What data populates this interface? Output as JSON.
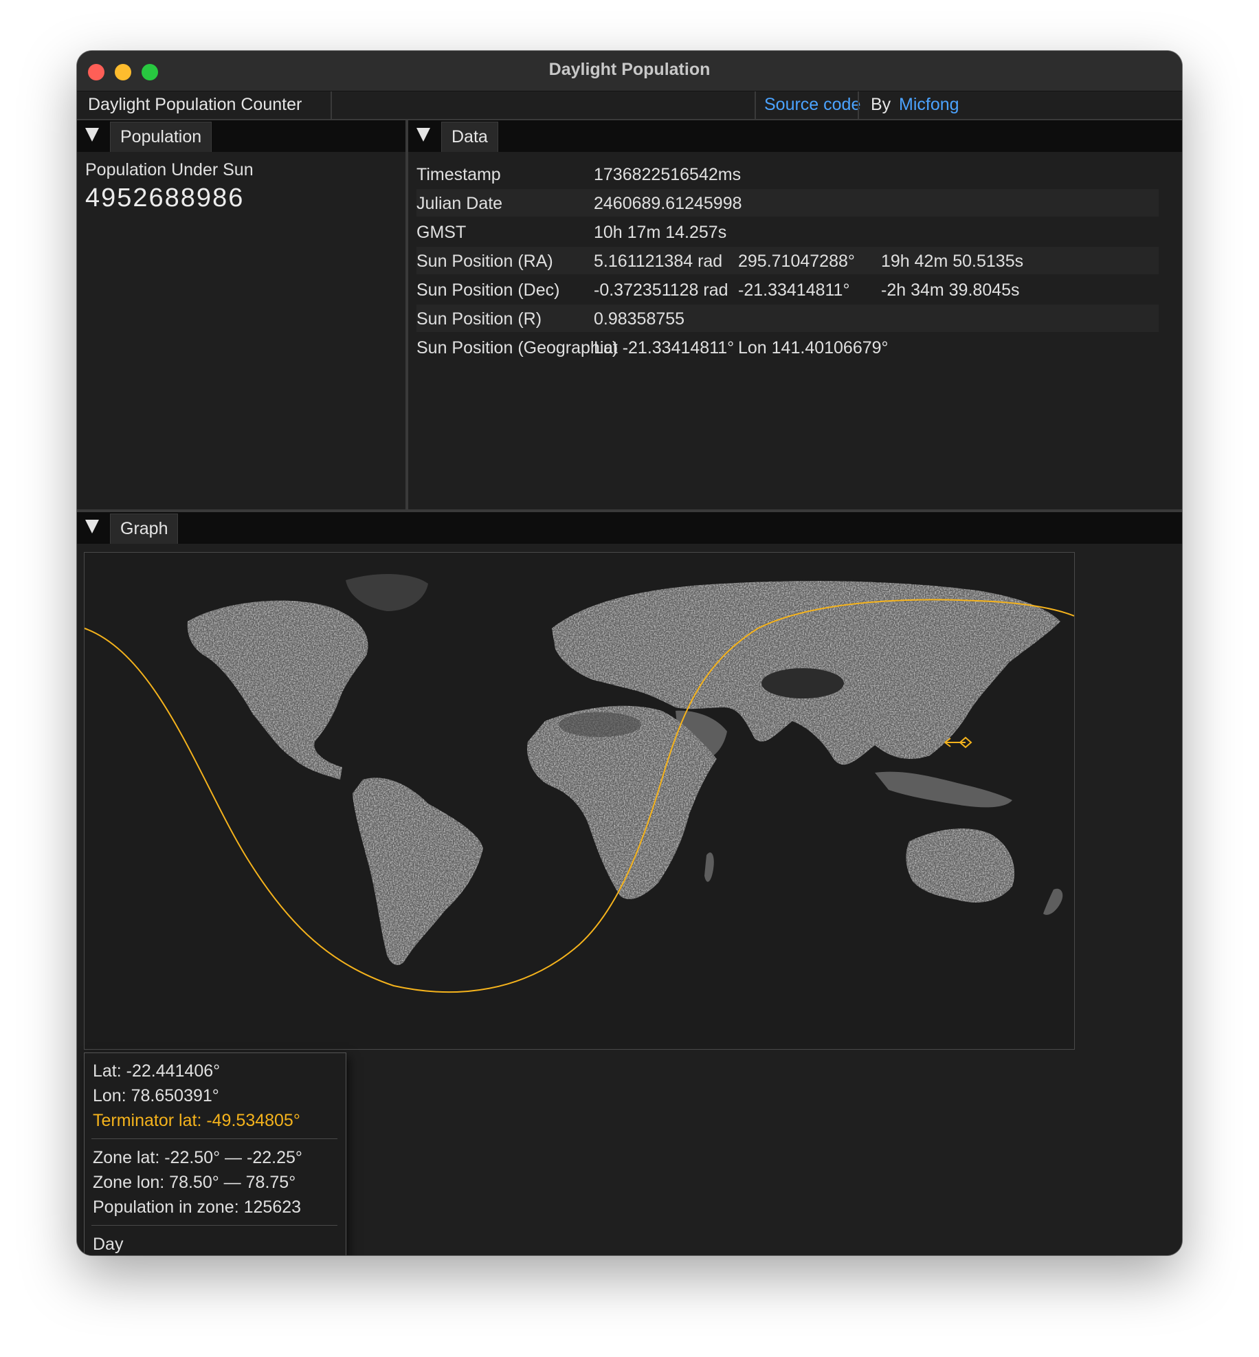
{
  "window": {
    "title": "Daylight Population"
  },
  "menubar": {
    "app_name": "Daylight Population Counter",
    "source_link": "Source code",
    "by_label": "By",
    "author_link": "Micfong"
  },
  "population_panel": {
    "tab_label": "Population",
    "label": "Population Under Sun",
    "value": "4952688986"
  },
  "data_panel": {
    "tab_label": "Data",
    "rows": [
      {
        "label": "Timestamp",
        "v1": "1736822516542ms",
        "v2": "",
        "v3": ""
      },
      {
        "label": "Julian Date",
        "v1": "2460689.61245998",
        "v2": "",
        "v3": ""
      },
      {
        "label": "GMST",
        "v1": "10h 17m 14.257s",
        "v2": "",
        "v3": ""
      },
      {
        "label": "Sun Position (RA)",
        "v1": "5.161121384 rad",
        "v2": "295.71047288°",
        "v3": "19h 42m 50.5135s"
      },
      {
        "label": "Sun Position (Dec)",
        "v1": "-0.372351128 rad",
        "v2": "-21.33414811°",
        "v3": "-2h 34m 39.8045s"
      },
      {
        "label": "Sun Position (R)",
        "v1": "0.98358755",
        "v2": "",
        "v3": ""
      },
      {
        "label": "Sun Position (Geographic)",
        "v1": "Lat -21.33414811°",
        "v2": "Lon 141.40106679°",
        "v3": ""
      }
    ]
  },
  "graph_panel": {
    "tab_label": "Graph",
    "terminator_color": "#f5b31c",
    "tooltip": {
      "lat": "Lat: -22.441406°",
      "lon": "Lon: 78.650391°",
      "terminator_lat": "Terminator lat: -49.534805°",
      "zone_lat": "Zone lat: -22.50° — -22.25°",
      "zone_lon": "Zone lon: 78.50° — 78.75°",
      "zone_population": "Population in zone: 125623",
      "state": "Day"
    }
  },
  "colors": {
    "accent_link": "#4ba3ff",
    "terminator": "#f5b31c",
    "window_bg": "#1f1f1f"
  }
}
